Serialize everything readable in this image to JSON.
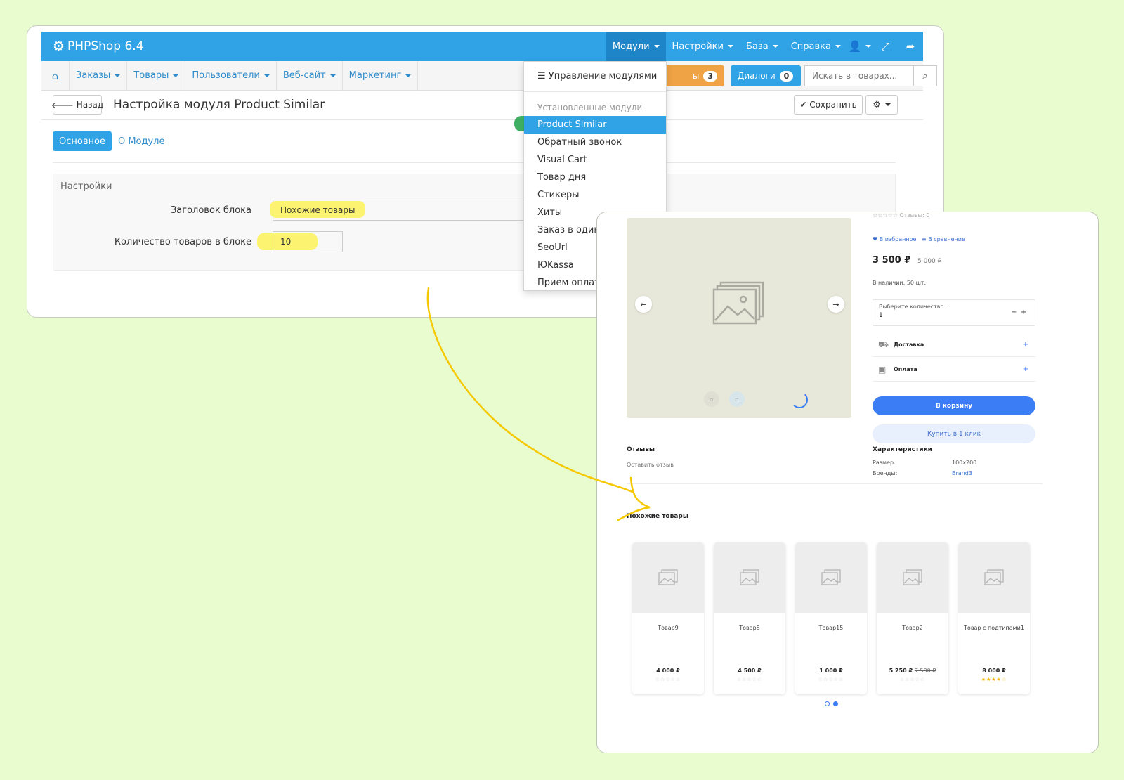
{
  "admin": {
    "brand": "PHPShop 6.4",
    "top_menu": [
      {
        "label": "Модули"
      },
      {
        "label": "Настройки"
      },
      {
        "label": "База"
      },
      {
        "label": "Справка"
      }
    ],
    "nav": [
      {
        "label": "Заказы"
      },
      {
        "label": "Товары"
      },
      {
        "label": "Пользователи"
      },
      {
        "label": "Веб-сайт"
      },
      {
        "label": "Маркетинг"
      }
    ],
    "orders_badge_text": "ы",
    "orders_count": "3",
    "dialogs_label": "Диалоги",
    "dialogs_count": "0",
    "search_placeholder": "Искать в товарах...",
    "back_label": "Назад",
    "page_title": "Настройка модуля Product Similar",
    "save_label": "Сохранить",
    "tabs": [
      {
        "label": "Основное"
      },
      {
        "label": "О Модуле"
      }
    ],
    "panel_title": "Настройки",
    "fields": [
      {
        "label": "Заголовок блока",
        "value": "Похожие товары"
      },
      {
        "label": "Количество товаров в блоке",
        "value": "10"
      }
    ],
    "dropdown": {
      "manage_label": "Управление модулями",
      "installed_header": "Установленные модули",
      "items": [
        {
          "label": "Product Similar"
        },
        {
          "label": "Обратный звонок"
        },
        {
          "label": "Visual Cart"
        },
        {
          "label": "Товар дня"
        },
        {
          "label": "Стикеры"
        },
        {
          "label": "Хиты"
        },
        {
          "label": "Заказ в один"
        },
        {
          "label": "SeoUrl"
        },
        {
          "label": "ЮKassa"
        },
        {
          "label": "Прием оплат"
        }
      ]
    }
  },
  "store": {
    "reviews_count_text": "Отзывы: 0",
    "favorites_label": "В избранное",
    "compare_label": "В сравнение",
    "price": "3 500 ₽",
    "old_price": "5 000 ₽",
    "stock": "В наличии: 50 шт.",
    "qty_label": "Выберите количество:",
    "qty_value": "1",
    "qty_minus": "−",
    "qty_plus": "+",
    "delivery_label": "Доставка",
    "payment_label": "Оплата",
    "cart_label": "В корзину",
    "oneclick_label": "Купить в 1 клик",
    "reviews_title": "Отзывы",
    "leave_review": "Оставить отзыв",
    "specs_title": "Характеристики",
    "specs": [
      {
        "name": "Размер:",
        "value": "100x200"
      },
      {
        "name": "Бренды:",
        "value": "Brand3"
      }
    ],
    "similar_title": "Похожие товары",
    "products": [
      {
        "name": "Товар9",
        "price": "4 000 ₽",
        "old_price": "",
        "rating": 0
      },
      {
        "name": "Товар8",
        "price": "4 500 ₽",
        "old_price": "",
        "rating": 0
      },
      {
        "name": "Товар15",
        "price": "1 000 ₽",
        "old_price": "",
        "rating": 0
      },
      {
        "name": "Товар2",
        "price": "5 250 ₽",
        "old_price": "7 500 ₽",
        "rating": 0
      },
      {
        "name": "Товар с подтипами1",
        "price": "8 000 ₽",
        "old_price": "",
        "rating": 4
      }
    ]
  },
  "colors": {
    "admin_primary": "#2fa3e6",
    "highlight": "#ffee00",
    "store_accent": "#3b7df5",
    "background": "#e8fcd0"
  }
}
